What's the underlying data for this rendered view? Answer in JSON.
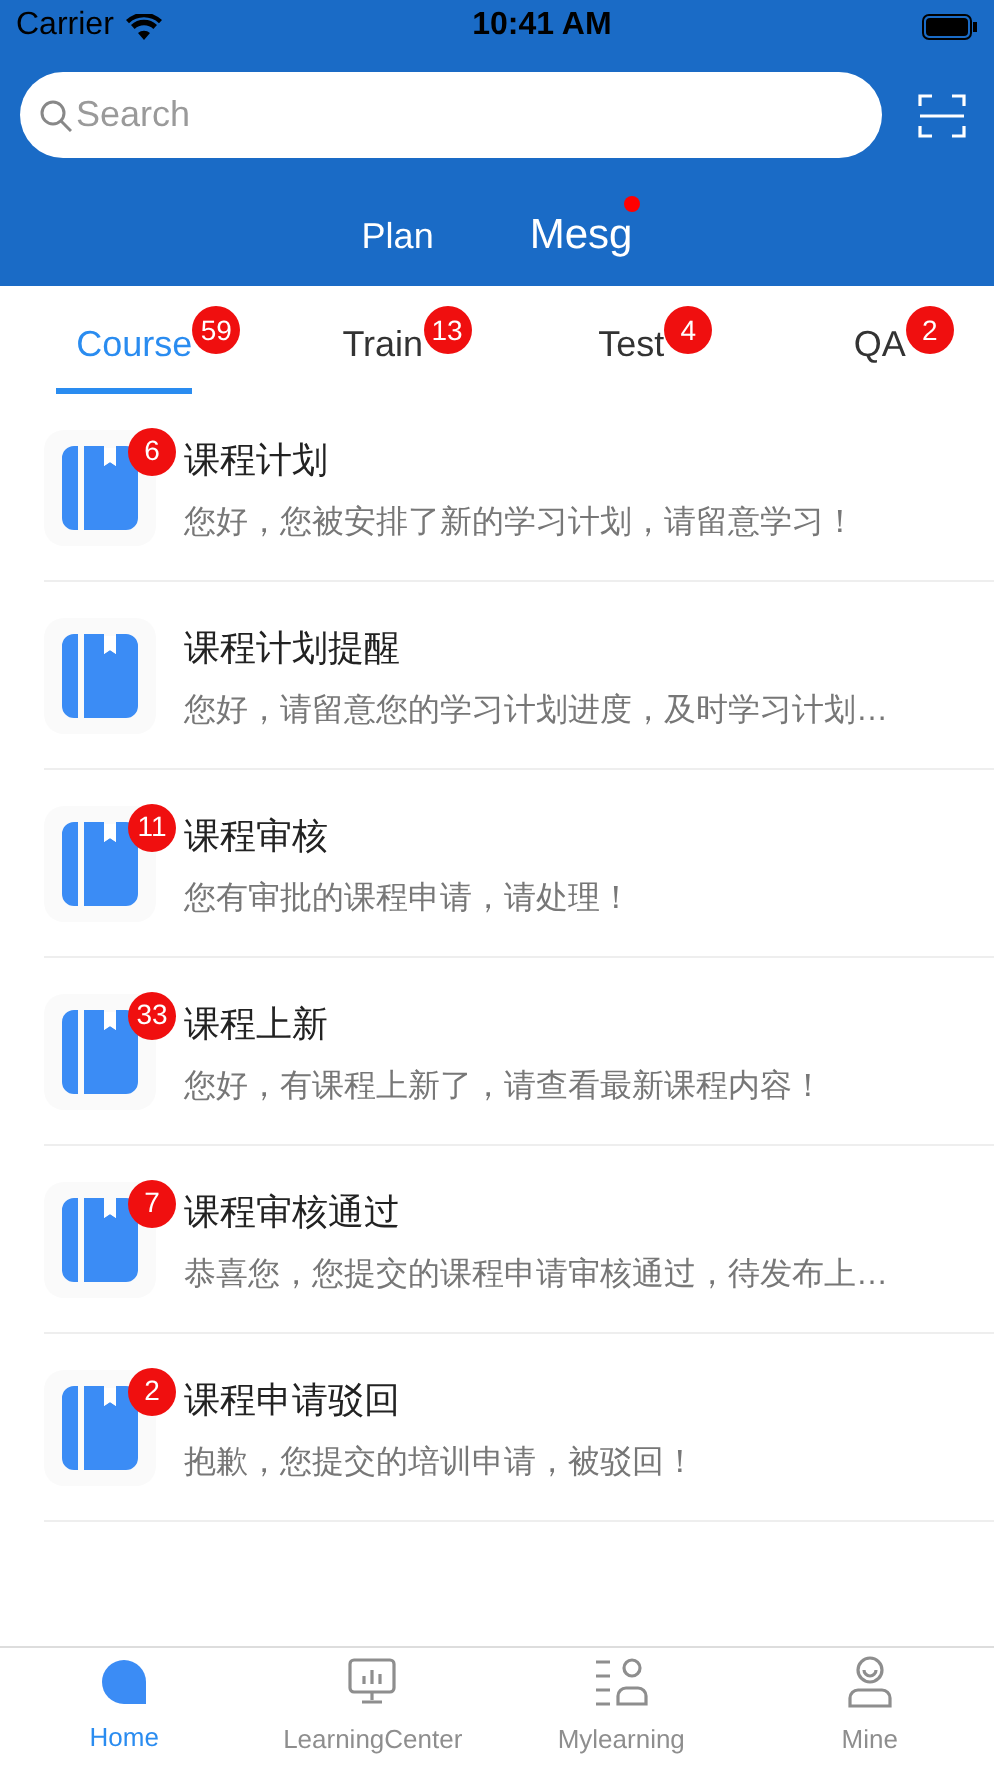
{
  "status_bar": {
    "carrier": "Carrier",
    "time": "10:41 AM"
  },
  "search": {
    "placeholder": "Search"
  },
  "top_tabs": [
    {
      "label": "Plan",
      "selected": false,
      "dot": false
    },
    {
      "label": "Mesg",
      "selected": true,
      "dot": true
    }
  ],
  "category_tabs": [
    {
      "label": "Course",
      "badge": "59",
      "selected": true
    },
    {
      "label": "Train",
      "badge": "13",
      "selected": false
    },
    {
      "label": "Test",
      "badge": "4",
      "selected": false
    },
    {
      "label": "QA",
      "badge": "2",
      "selected": false
    }
  ],
  "messages": [
    {
      "title": "课程计划",
      "text": "您好，您被安排了新的学习计划，请留意学习！",
      "badge": "6"
    },
    {
      "title": "课程计划提醒",
      "text": "您好，请留意您的学习计划进度，及时学习计划…"
    },
    {
      "title": "课程审核",
      "text": "您有审批的课程申请，请处理！",
      "badge": "11"
    },
    {
      "title": "课程上新",
      "text": "您好，有课程上新了，请查看最新课程内容！",
      "badge": "33"
    },
    {
      "title": "课程审核通过",
      "text": "恭喜您，您提交的课程申请审核通过，待发布上…",
      "badge": "7"
    },
    {
      "title": "课程申请驳回",
      "text": "抱歉，您提交的培训申请，被驳回！",
      "badge": "2"
    }
  ],
  "bottom_nav": [
    {
      "label": "Home",
      "kind": "home",
      "selected": true
    },
    {
      "label": "LearningCenter",
      "kind": "monitor",
      "selected": false
    },
    {
      "label": "Mylearning",
      "kind": "list-person",
      "selected": false
    },
    {
      "label": "Mine",
      "kind": "person",
      "selected": false
    }
  ]
}
